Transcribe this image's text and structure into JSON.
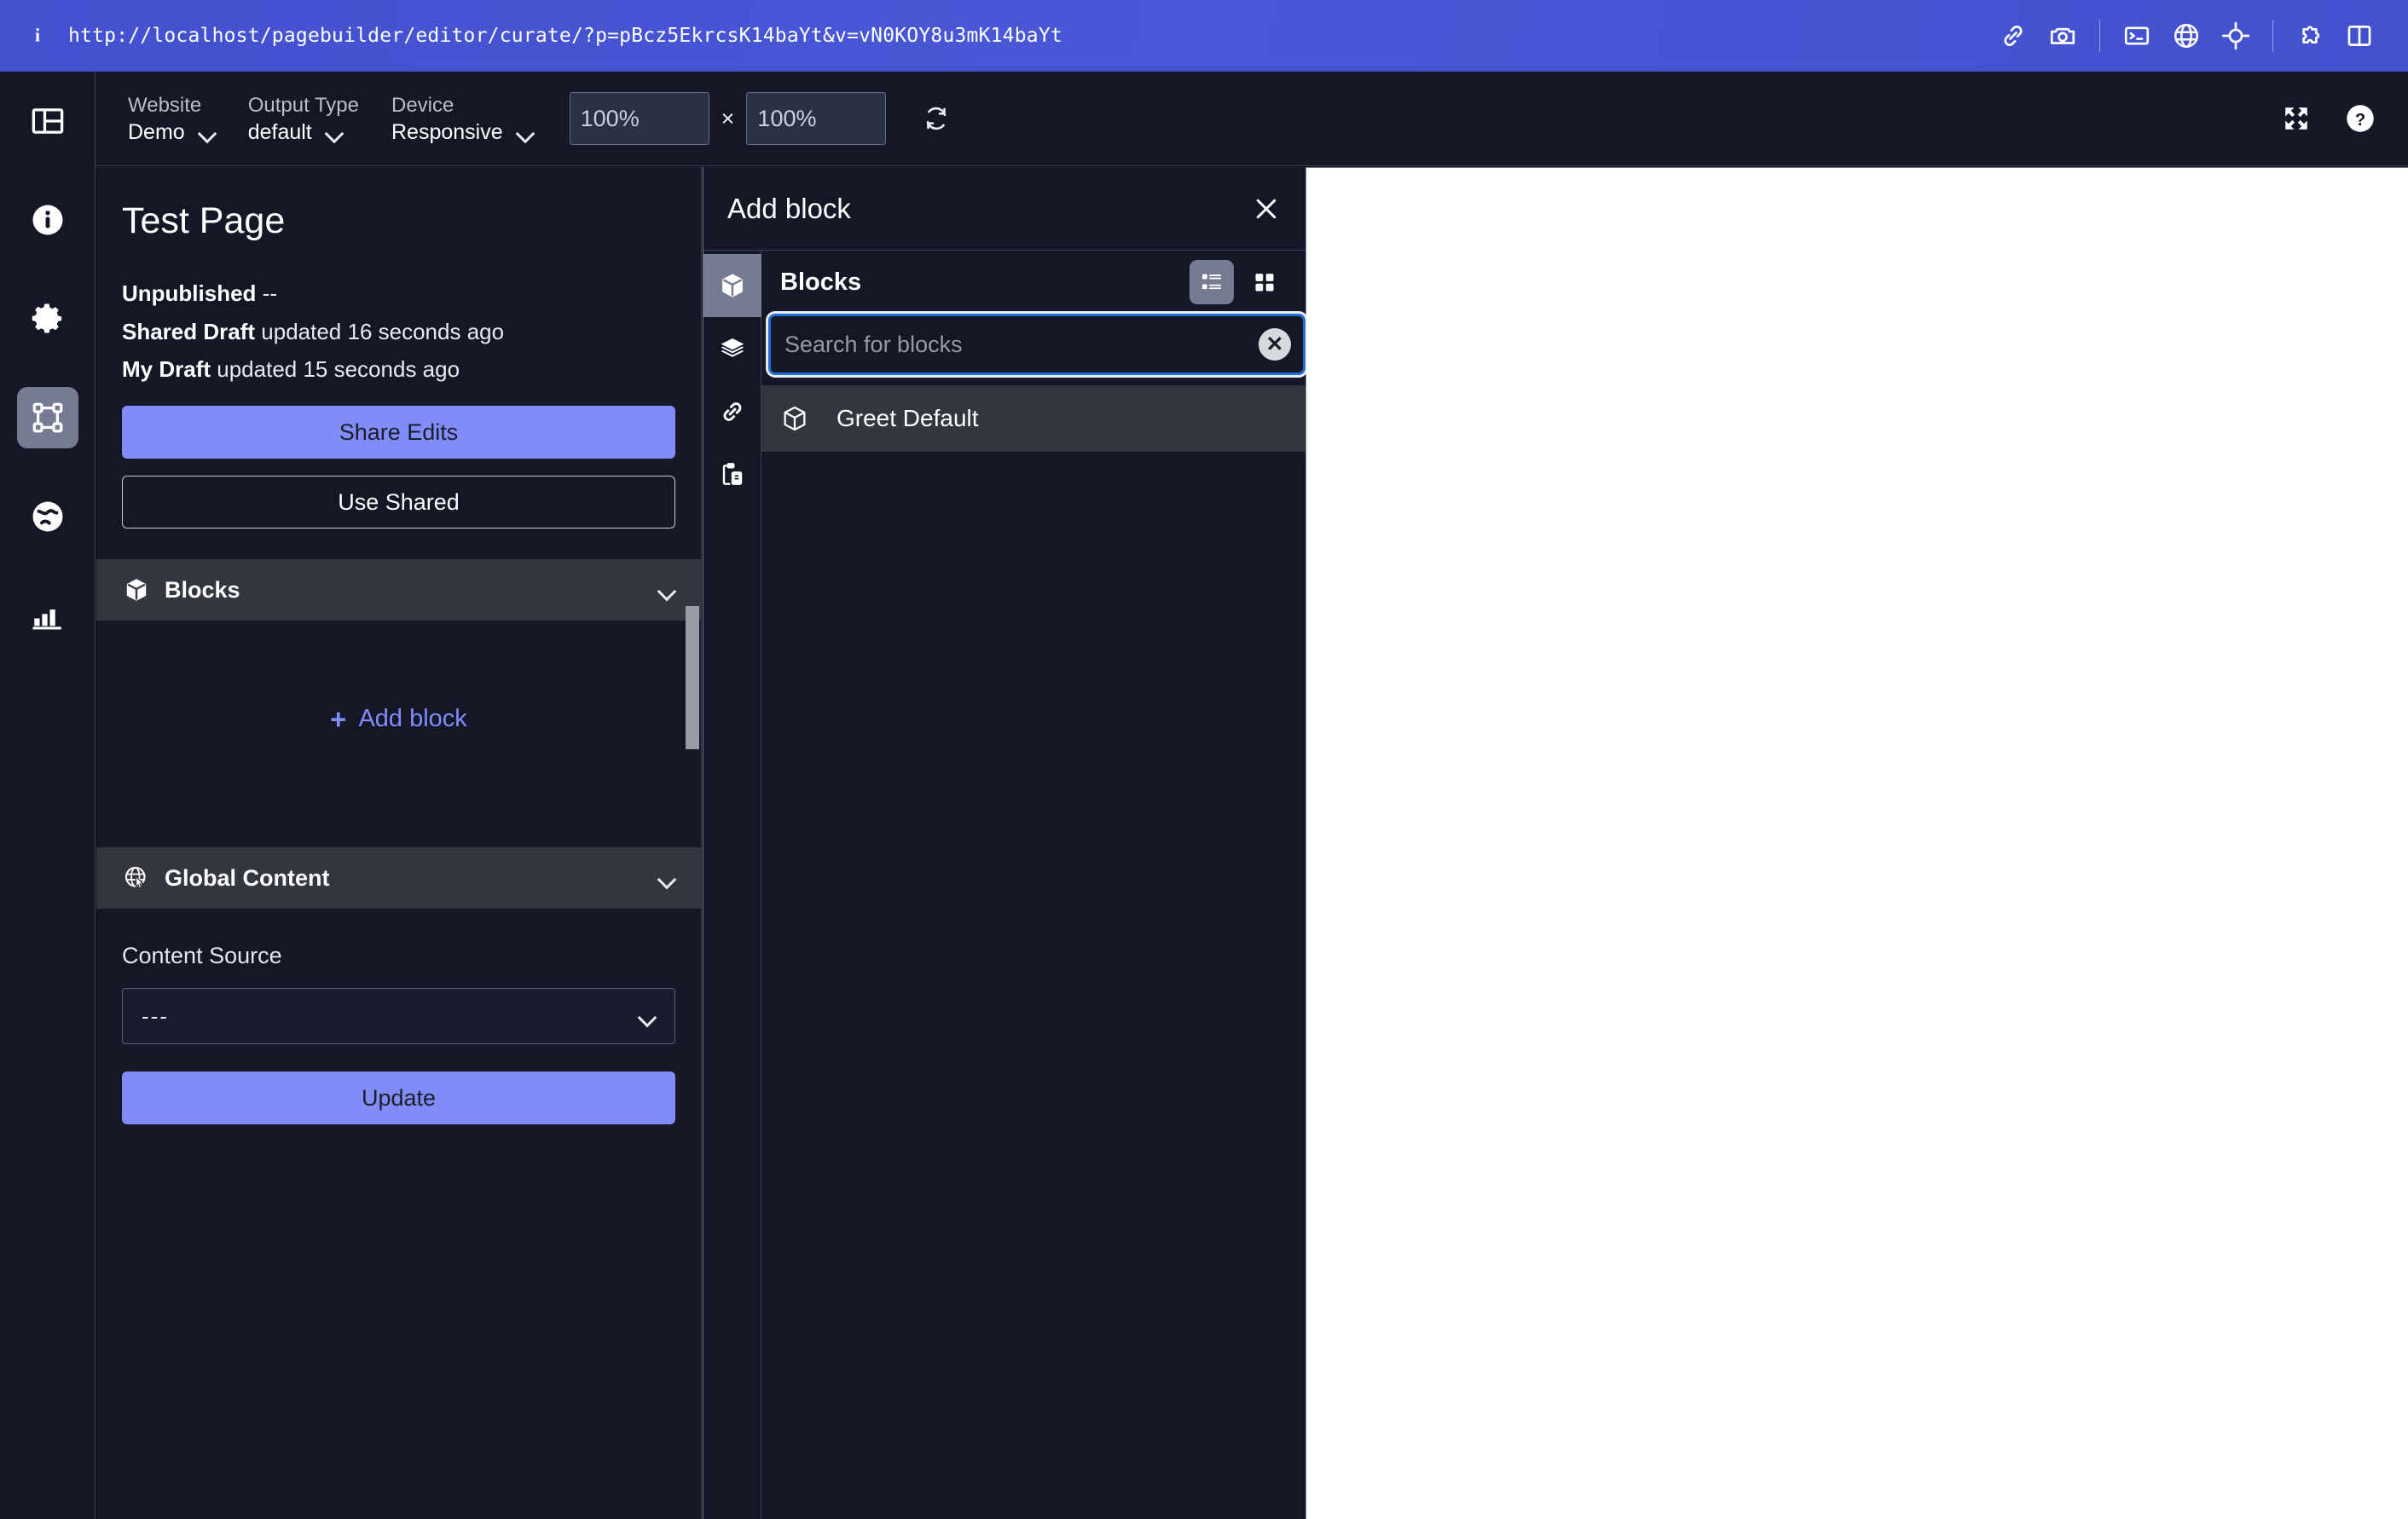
{
  "urlbar": {
    "info_icon": "info-icon",
    "url": "http://localhost/pagebuilder/editor/curate/?p=pBcz5EkrcsK14baYt&v=vN0KOY8u3mK14baYt",
    "icons": [
      {
        "name": "link-icon",
        "label": "Copy link"
      },
      {
        "name": "camera-icon",
        "label": "Screenshot"
      },
      {
        "name": "terminal-icon",
        "label": "Console"
      },
      {
        "name": "globe-icon",
        "label": "Network"
      },
      {
        "name": "target-icon",
        "label": "Select element"
      },
      {
        "name": "puzzle-icon",
        "label": "Extensions"
      },
      {
        "name": "panel-icon",
        "label": "Toggle panel"
      }
    ]
  },
  "rail": {
    "items": [
      {
        "name": "layout-icon",
        "label": "Layout",
        "active": false
      },
      {
        "name": "info-icon",
        "label": "Info",
        "active": false
      },
      {
        "name": "gear-icon",
        "label": "Settings",
        "active": false
      },
      {
        "name": "frame-icon",
        "label": "Curate",
        "active": true
      },
      {
        "name": "globe-icon",
        "label": "Global",
        "active": false
      },
      {
        "name": "chart-icon",
        "label": "Analytics",
        "active": false
      }
    ]
  },
  "toolbar": {
    "website_label": "Website",
    "website_value": "Demo",
    "output_type_label": "Output Type",
    "output_type_value": "default",
    "device_label": "Device",
    "device_value": "Responsive",
    "width_value": "100%",
    "height_value": "100%",
    "size_separator": "×",
    "refresh_icon": "refresh-icon",
    "expand_icon": "expand-icon",
    "help_icon": "help-icon"
  },
  "panel": {
    "page_title": "Test Page",
    "status": {
      "unpublished_label": "Unpublished",
      "unpublished_value": "--",
      "shared_draft_label": "Shared Draft",
      "shared_draft_value": "updated 16 seconds ago",
      "my_draft_label": "My Draft",
      "my_draft_value": "updated 15 seconds ago"
    },
    "share_edits_label": "Share Edits",
    "use_shared_label": "Use Shared",
    "blocks_section": {
      "title": "Blocks",
      "icon": "cube-icon",
      "chevron": "chevron-down-icon",
      "add_block_label": "Add block",
      "add_block_plus": "+"
    },
    "global_content_section": {
      "title": "Global Content",
      "icon": "globe-cursor-icon",
      "chevron": "chevron-down-icon",
      "content_source_label": "Content Source",
      "content_source_value": "---",
      "update_label": "Update"
    }
  },
  "modal": {
    "title": "Add block",
    "close_icon": "close-icon",
    "rail": [
      {
        "name": "cube-icon",
        "label": "Blocks",
        "active": true
      },
      {
        "name": "layers-icon",
        "label": "Layouts",
        "active": false
      },
      {
        "name": "link-icon",
        "label": "Links",
        "active": false
      },
      {
        "name": "paste-icon",
        "label": "Paste",
        "active": false
      }
    ],
    "sub_title": "Blocks",
    "view_list_icon": "list-view-icon",
    "view_grid_icon": "grid-view-icon",
    "search_placeholder": "Search for blocks",
    "search_value": "",
    "search_clear_icon": "clear-icon",
    "results": [
      {
        "icon": "cube-icon",
        "label": "Greet Default"
      }
    ]
  },
  "colors": {
    "accent": "#818cf8",
    "urlbar": "#4351cf",
    "panel_bg": "#141826",
    "section_head": "#33363f",
    "active_rail": "#767a93",
    "focus_ring": "#1d6fd4",
    "canvas": "#ffffff"
  }
}
